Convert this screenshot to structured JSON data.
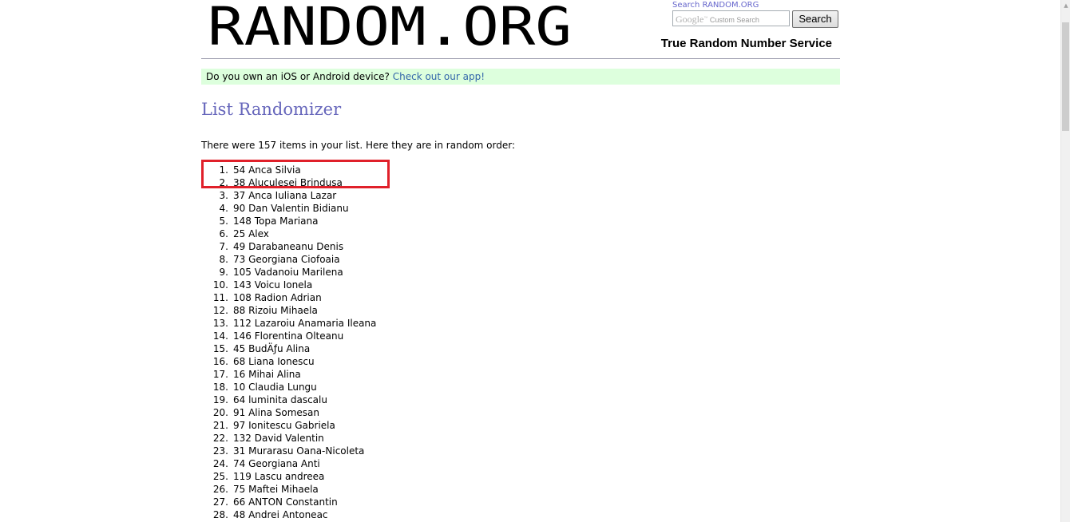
{
  "header": {
    "logo_text": "RANDOM.ORG",
    "search_link": "Search RANDOM.ORG",
    "search_placeholder": "Custom Search",
    "search_brand": "Google",
    "search_button": "Search",
    "tagline": "True Random Number Service"
  },
  "banner": {
    "text": "Do you own an iOS or Android device?",
    "link_text": "Check out our app!"
  },
  "main": {
    "title": "List Randomizer",
    "intro": "There were 157 items in your list. Here they are in random order:",
    "items": [
      {
        "n": "1.",
        "text": "54 Anca Silvia"
      },
      {
        "n": "2.",
        "text": "38 Aluculesei Brindusa"
      },
      {
        "n": "3.",
        "text": "37 Anca Iuliana Lazar"
      },
      {
        "n": "4.",
        "text": "90 Dan Valentin Bidianu"
      },
      {
        "n": "5.",
        "text": "148 Topa Mariana"
      },
      {
        "n": "6.",
        "text": "25 Alex"
      },
      {
        "n": "7.",
        "text": "49 Darabaneanu Denis"
      },
      {
        "n": "8.",
        "text": "73 Georgiana Ciofoaia"
      },
      {
        "n": "9.",
        "text": "105 Vadanoiu Marilena"
      },
      {
        "n": "10.",
        "text": "143 Voicu Ionela"
      },
      {
        "n": "11.",
        "text": "108 Radion Adrian"
      },
      {
        "n": "12.",
        "text": "88 Rizoiu Mihaela"
      },
      {
        "n": "13.",
        "text": "112 Lazaroiu Anamaria Ileana"
      },
      {
        "n": "14.",
        "text": "146 Florentina Olteanu"
      },
      {
        "n": "15.",
        "text": "45 BudÄƒu Alina"
      },
      {
        "n": "16.",
        "text": "68 Liana Ionescu"
      },
      {
        "n": "17.",
        "text": "16 Mihai Alina"
      },
      {
        "n": "18.",
        "text": "10 Claudia Lungu"
      },
      {
        "n": "19.",
        "text": "64 luminita dascalu"
      },
      {
        "n": "20.",
        "text": "91 Alina Somesan"
      },
      {
        "n": "21.",
        "text": "97 Ionitescu Gabriela"
      },
      {
        "n": "22.",
        "text": "132 David Valentin"
      },
      {
        "n": "23.",
        "text": "31 Murarasu Oana-Nicoleta"
      },
      {
        "n": "24.",
        "text": "74 Georgiana Anti"
      },
      {
        "n": "25.",
        "text": "119 Lascu andreea"
      },
      {
        "n": "26.",
        "text": "75 Maftei Mihaela"
      },
      {
        "n": "27.",
        "text": "66 ANTON Constantin"
      },
      {
        "n": "28.",
        "text": "48 Andrei Antoneac"
      }
    ]
  },
  "colors": {
    "title": "#6666bb",
    "link": "#3366aa",
    "banner_bg": "#ddffdd",
    "highlight": "#e0202a"
  },
  "icons": {
    "scroll_up": "scroll-up-arrow-icon"
  }
}
